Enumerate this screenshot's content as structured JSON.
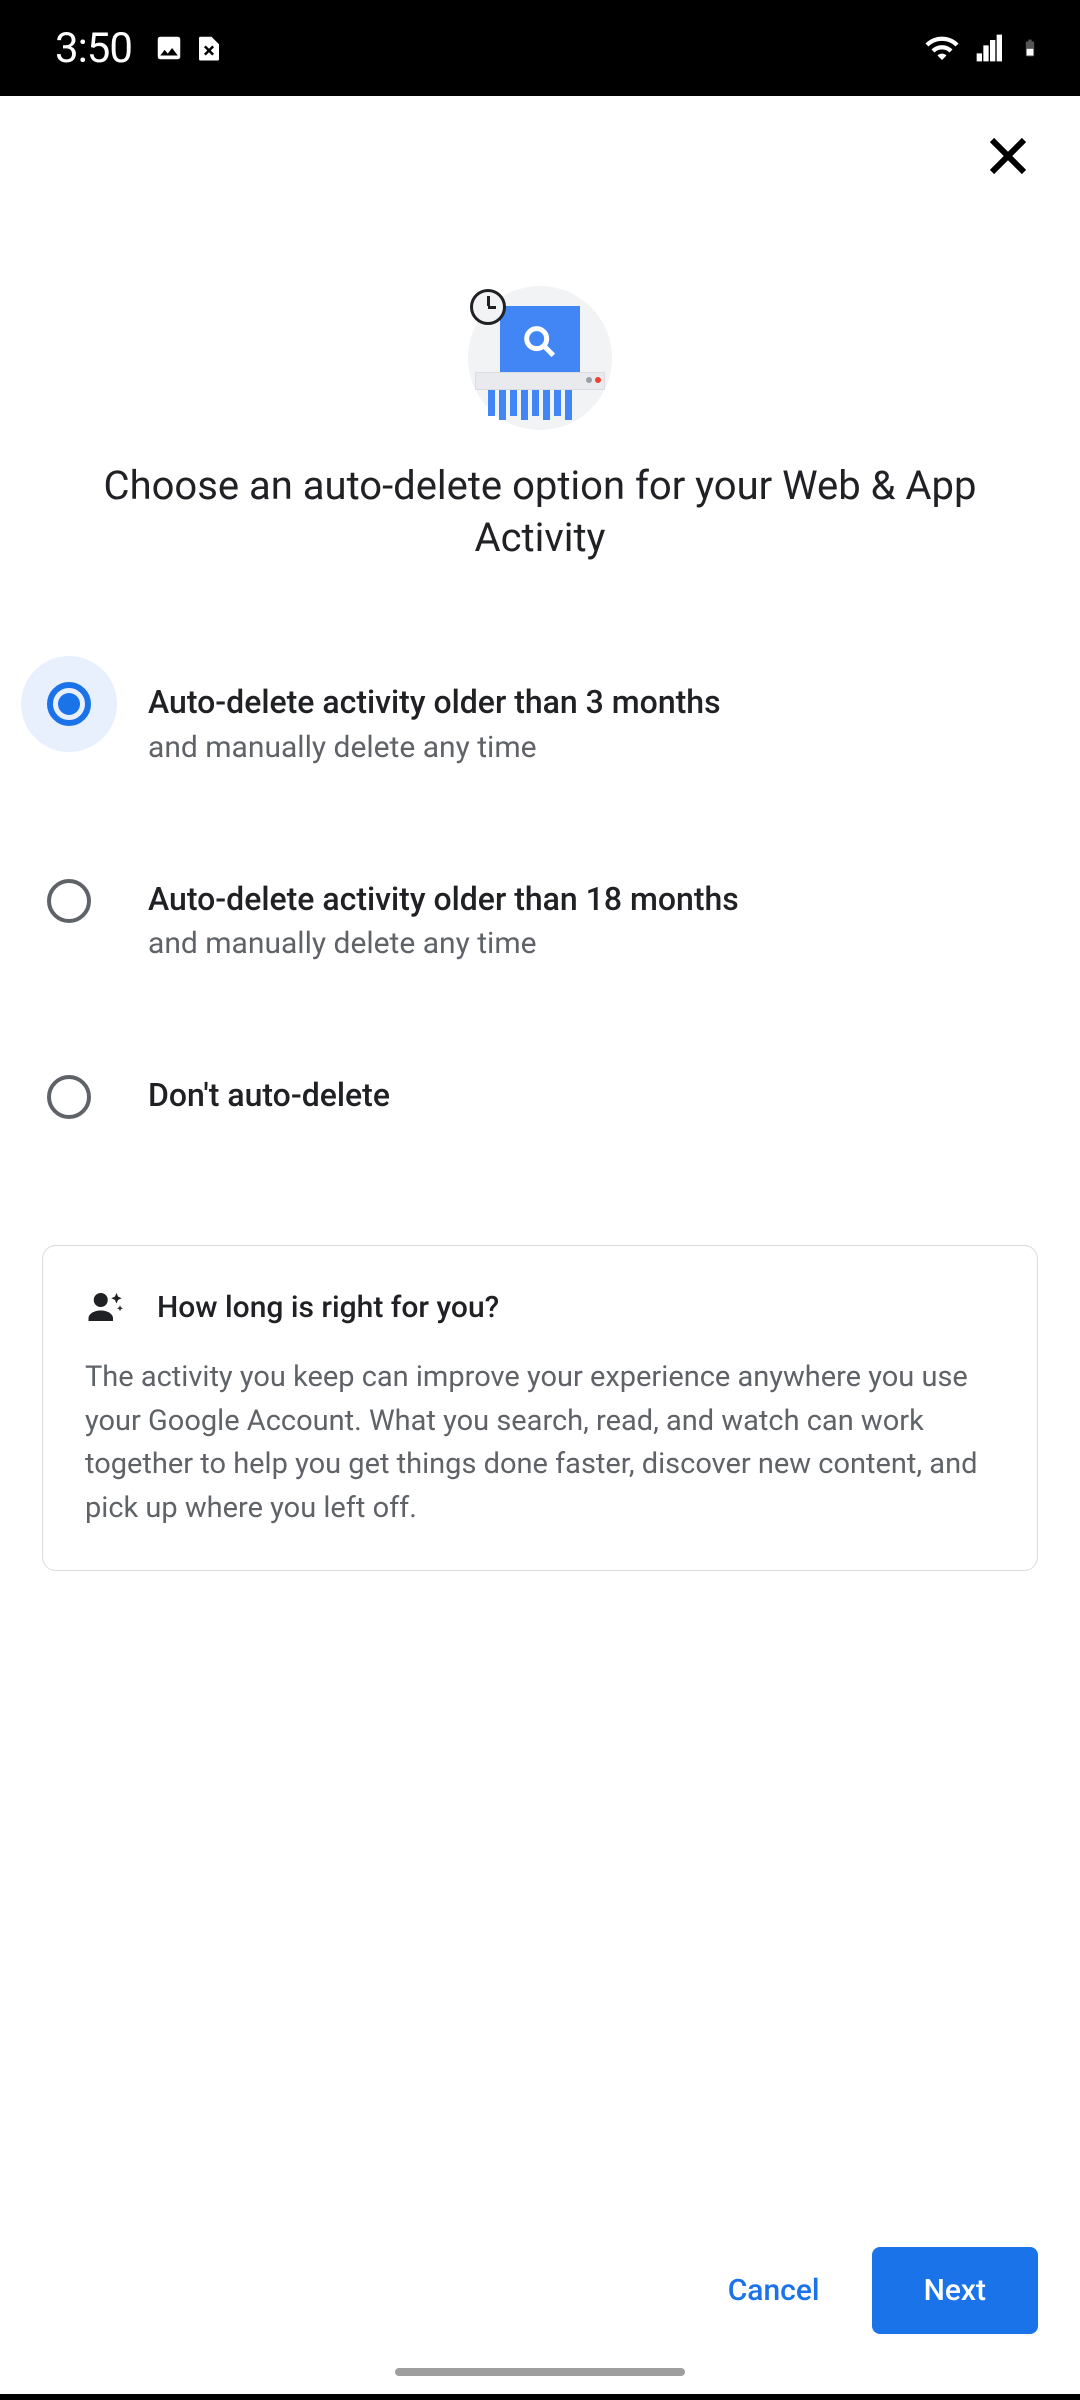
{
  "status": {
    "time": "3:50"
  },
  "header": {
    "close_aria": "Close"
  },
  "title": "Choose an auto-delete option for your Web & App Activity",
  "options": [
    {
      "title": "Auto-delete activity older than 3 months",
      "sub": "and manually delete any time",
      "selected": true
    },
    {
      "title": "Auto-delete activity older than 18 months",
      "sub": "and manually delete any time",
      "selected": false
    },
    {
      "title": "Don't auto-delete",
      "sub": "",
      "selected": false
    }
  ],
  "info": {
    "title": "How long is right for you?",
    "body": "The activity you keep can improve your experience anywhere you use your Google Account. What you search, read, and watch can work together to help you get things done faster, discover new content, and pick up where you left off."
  },
  "footer": {
    "cancel": "Cancel",
    "next": "Next"
  }
}
